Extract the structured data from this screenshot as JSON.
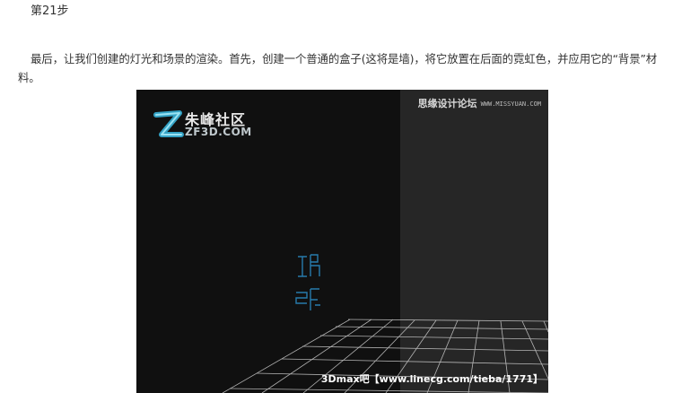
{
  "step": {
    "title": "第21步"
  },
  "paragraph": {
    "text": "最后，让我们创建的灯光和场景的渲染。首先，创建一个普通的盒子(这将是墙)，将它放置在后面的霓虹色，并应用它的“背景”材料。"
  },
  "render": {
    "logo_cn": "朱峰社区",
    "logo_en": "ZF3D.COM",
    "watermark_top_cn": "思缘设计论坛",
    "watermark_top_url": "WWW.MISSYUAN.COM",
    "watermark_bottom": "3Dmax吧【www.linecg.com/tieba/1771】",
    "neon_color": "#2f9fe0",
    "background_color": "#101010",
    "wall_color": "#262626",
    "grid_color": "#cfcfcf"
  }
}
